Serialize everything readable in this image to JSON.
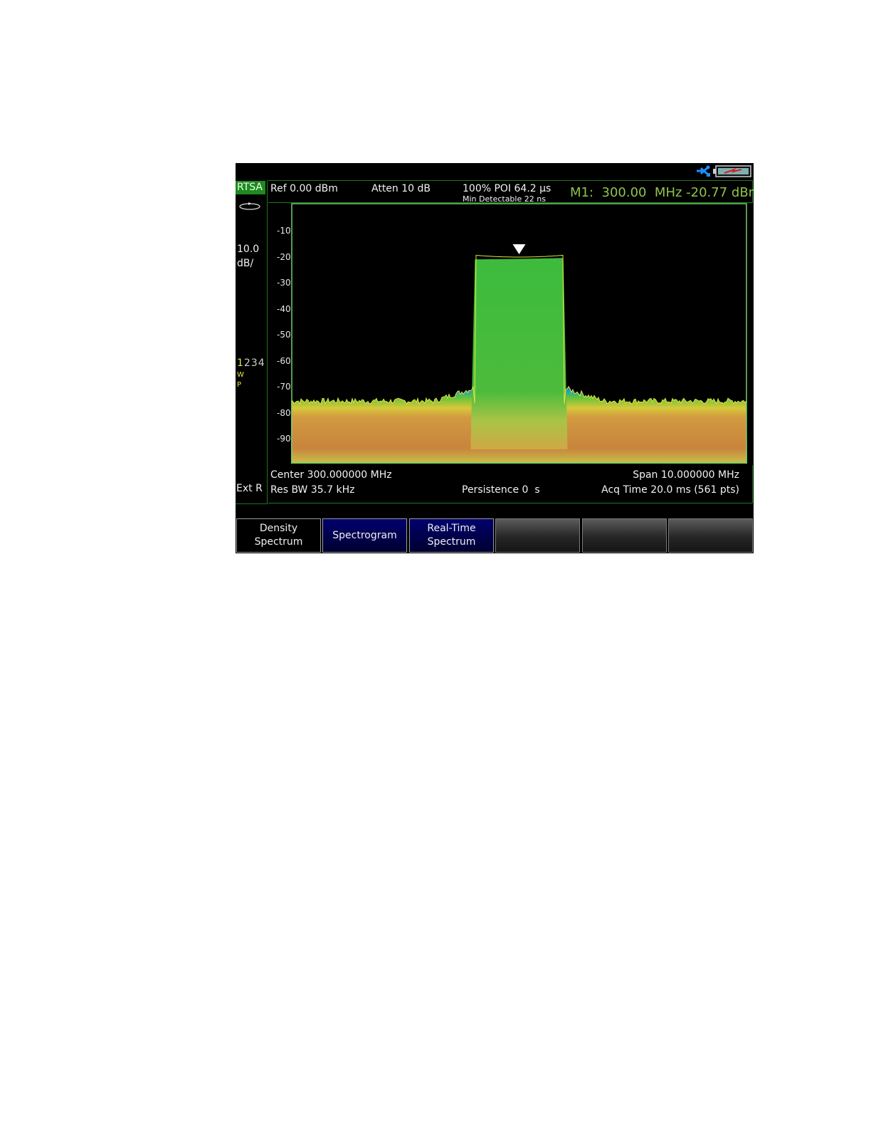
{
  "status_bar": {
    "icons": [
      "usb-icon",
      "battery-icon"
    ],
    "colors": {
      "usb": "#1e8fff",
      "battery": "#7fb0b0",
      "battery_bolt": "#d42020"
    }
  },
  "left_panel": {
    "mode": "RTSA",
    "scale_value": "10.0",
    "scale_unit": "dB/",
    "traces": [
      "1",
      "2",
      "3",
      "4"
    ],
    "trace_type": "W",
    "detector": "P",
    "trigger": "Ext R"
  },
  "header": {
    "ref_level": "Ref 0.00 dBm",
    "attenuation": "Atten 10 dB",
    "poi": "100% POI 64.2 µs",
    "min_detectable": "Min Detectable 22 ns",
    "marker_readout": "M1:  300.00  MHz -20.77 dBm"
  },
  "footer": {
    "center": "Center 300.000000 MHz",
    "span": "Span 10.000000 MHz",
    "res_bw": "Res BW 35.7 kHz",
    "persistence": "Persistence 0  s",
    "acq_time": "Acq Time 20.0 ms (561 pts)"
  },
  "softkeys": [
    {
      "label": "Density\nSpectrum",
      "style": "dark"
    },
    {
      "label": "Spectrogram",
      "style": "blue"
    },
    {
      "label": "Real-Time\nSpectrum",
      "style": "blue"
    },
    {
      "label": "",
      "style": "empty"
    },
    {
      "label": "",
      "style": "empty"
    },
    {
      "label": "",
      "style": "empty"
    }
  ],
  "chart_data": {
    "type": "area",
    "y_ticks": [
      "-10",
      "-20",
      "-30",
      "-40",
      "-50",
      "-60",
      "-70",
      "-80",
      "-90"
    ],
    "ylim": [
      -100,
      0
    ],
    "x_center_mhz": 300.0,
    "x_span_mhz": 10.0,
    "xlim_mhz": [
      295.0,
      305.0
    ],
    "noise_floor_dbm": -76,
    "signal": {
      "start_mhz": 299.0,
      "end_mhz": 301.0,
      "level_dbm": -20
    },
    "marker": {
      "name": "M1",
      "x_mhz": 300.0,
      "y_dbm": -20.77
    },
    "grid": false,
    "colors": {
      "signal": "#3dbb3d",
      "noise_top": "#3a4fd8",
      "floor": "#c8843c",
      "trace": "#e6e63c",
      "frame": "#6fcf6f"
    }
  }
}
